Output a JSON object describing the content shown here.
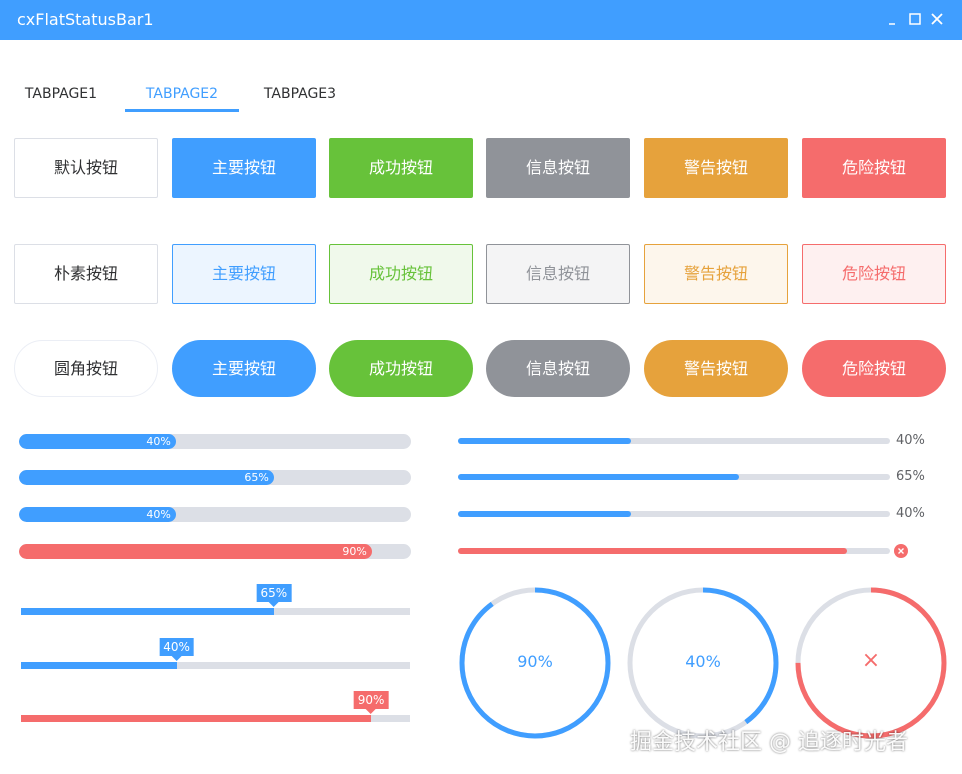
{
  "window": {
    "title": "cxFlatStatusBar1"
  },
  "tabs": [
    {
      "label": "TABPAGE1",
      "active": false
    },
    {
      "label": "TABPAGE2",
      "active": true
    },
    {
      "label": "TABPAGE3",
      "active": false
    }
  ],
  "buttons": {
    "default_row": [
      "默认按钮",
      "主要按钮",
      "成功按钮",
      "信息按钮",
      "警告按钮",
      "危险按钮"
    ],
    "plain_row": [
      "朴素按钮",
      "主要按钮",
      "成功按钮",
      "信息按钮",
      "警告按钮",
      "危险按钮"
    ],
    "round_row": [
      "圆角按钮",
      "主要按钮",
      "成功按钮",
      "信息按钮",
      "警告按钮",
      "危险按钮"
    ]
  },
  "progress_inside": [
    {
      "percent": 40,
      "label": "40%",
      "color": "#409eff"
    },
    {
      "percent": 65,
      "label": "65%",
      "color": "#409eff"
    },
    {
      "percent": 40,
      "label": "40%",
      "color": "#409eff"
    },
    {
      "percent": 90,
      "label": "90%",
      "color": "#f56c6c"
    }
  ],
  "progress_thin": [
    {
      "percent": 40,
      "label": "40%",
      "color": "#409eff",
      "status": "normal"
    },
    {
      "percent": 65,
      "label": "65%",
      "color": "#409eff",
      "status": "normal"
    },
    {
      "percent": 40,
      "label": "40%",
      "color": "#409eff",
      "status": "normal"
    },
    {
      "percent": 90,
      "label": "",
      "color": "#f56c6c",
      "status": "exception"
    }
  ],
  "sliders": [
    {
      "percent": 65,
      "label": "65%",
      "color": "#409eff"
    },
    {
      "percent": 40,
      "label": "40%",
      "color": "#409eff"
    },
    {
      "percent": 90,
      "label": "90%",
      "color": "#f56c6c"
    }
  ],
  "circles": [
    {
      "percent": 90,
      "label": "90%",
      "color": "#409eff",
      "status": "normal"
    },
    {
      "percent": 40,
      "label": "40%",
      "color": "#409eff",
      "status": "normal"
    },
    {
      "percent": 75,
      "label": "×",
      "color": "#f56c6c",
      "status": "exception"
    }
  ],
  "colors": {
    "track": "#dcdfe6",
    "accent": "#409eff",
    "danger": "#f56c6c"
  },
  "watermark": "掘金技术社区 @ 追逐时光者"
}
